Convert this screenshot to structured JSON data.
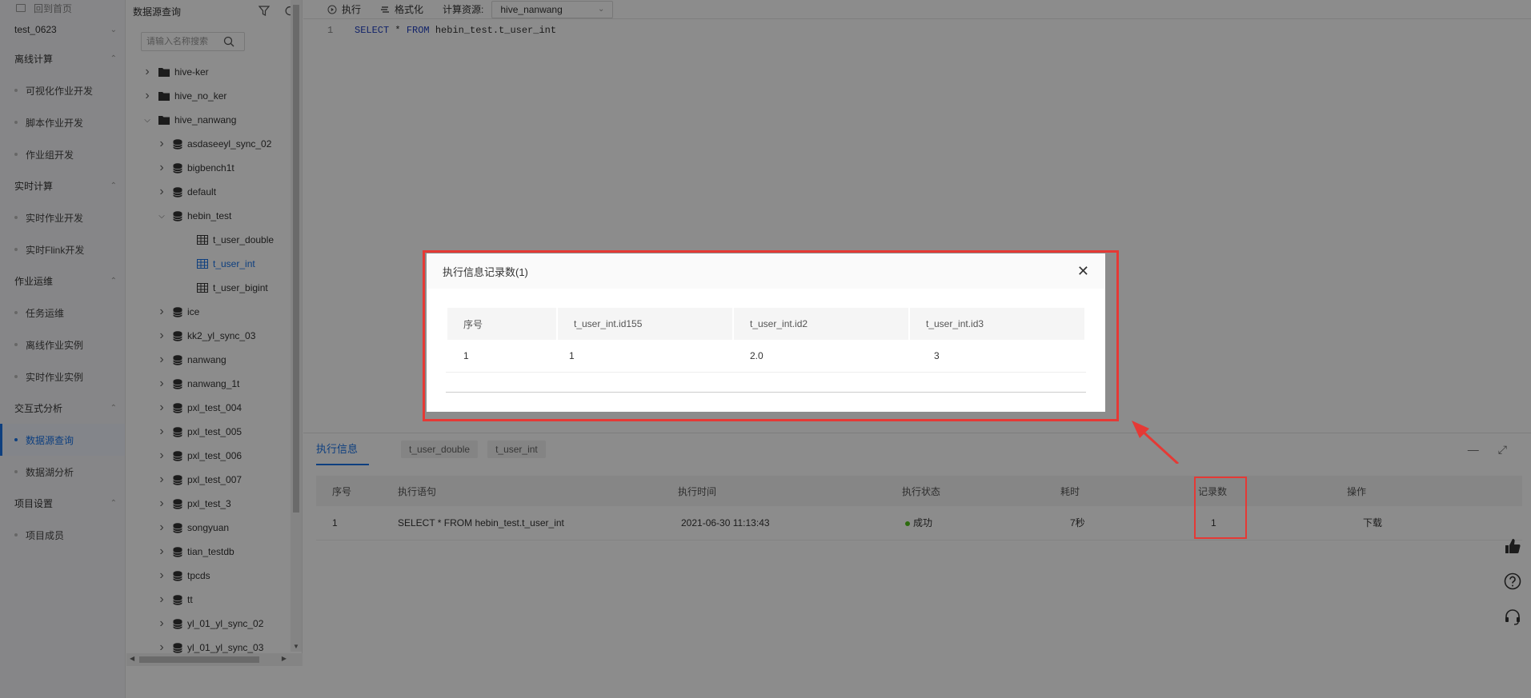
{
  "nav": {
    "home_label": "回到首页",
    "project": "test_0623",
    "groups": [
      {
        "label": "离线计算",
        "items": [
          "可视化作业开发",
          "脚本作业开发",
          "作业组开发"
        ]
      },
      {
        "label": "实时计算",
        "items": [
          "实时作业开发",
          "实时Flink开发"
        ]
      },
      {
        "label": "作业运维",
        "items": [
          "任务运维",
          "离线作业实例",
          "实时作业实例"
        ]
      },
      {
        "label": "交互式分析",
        "items": [
          "数据源查询",
          "数据湖分析"
        ]
      },
      {
        "label": "项目设置",
        "items": [
          "项目成员"
        ]
      }
    ],
    "active_item": "数据源查询"
  },
  "tree": {
    "title": "数据源查询",
    "search_placeholder": "请输入名称搜索",
    "nodes": [
      {
        "label": "hive-ker",
        "type": "folder",
        "level": 0,
        "expanded": false
      },
      {
        "label": "hive_no_ker",
        "type": "folder",
        "level": 0,
        "expanded": false
      },
      {
        "label": "hive_nanwang",
        "type": "folder",
        "level": 0,
        "expanded": true
      },
      {
        "label": "asdaseeyl_sync_02",
        "type": "db",
        "level": 1,
        "expanded": false
      },
      {
        "label": "bigbench1t",
        "type": "db",
        "level": 1,
        "expanded": false
      },
      {
        "label": "default",
        "type": "db",
        "level": 1,
        "expanded": false
      },
      {
        "label": "hebin_test",
        "type": "db",
        "level": 1,
        "expanded": true
      },
      {
        "label": "t_user_double",
        "type": "table",
        "level": 2
      },
      {
        "label": "t_user_int",
        "type": "table",
        "level": 2,
        "selected": true
      },
      {
        "label": "t_user_bigint",
        "type": "table",
        "level": 2
      },
      {
        "label": "ice",
        "type": "db",
        "level": 1,
        "expanded": false
      },
      {
        "label": "kk2_yl_sync_03",
        "type": "db",
        "level": 1,
        "expanded": false
      },
      {
        "label": "nanwang",
        "type": "db",
        "level": 1,
        "expanded": false
      },
      {
        "label": "nanwang_1t",
        "type": "db",
        "level": 1,
        "expanded": false
      },
      {
        "label": "pxl_test_004",
        "type": "db",
        "level": 1,
        "expanded": false
      },
      {
        "label": "pxl_test_005",
        "type": "db",
        "level": 1,
        "expanded": false
      },
      {
        "label": "pxl_test_006",
        "type": "db",
        "level": 1,
        "expanded": false
      },
      {
        "label": "pxl_test_007",
        "type": "db",
        "level": 1,
        "expanded": false
      },
      {
        "label": "pxl_test_3",
        "type": "db",
        "level": 1,
        "expanded": false
      },
      {
        "label": "songyuan",
        "type": "db",
        "level": 1,
        "expanded": false
      },
      {
        "label": "tian_testdb",
        "type": "db",
        "level": 1,
        "expanded": false
      },
      {
        "label": "tpcds",
        "type": "db",
        "level": 1,
        "expanded": false
      },
      {
        "label": "tt",
        "type": "db",
        "level": 1,
        "expanded": false
      },
      {
        "label": "yl_01_yl_sync_02",
        "type": "db",
        "level": 1,
        "expanded": false
      },
      {
        "label": "yl_01_yl_sync_03",
        "type": "db",
        "level": 1,
        "expanded": false
      }
    ]
  },
  "toolbar": {
    "run_label": "执行",
    "format_label": "格式化",
    "resource_label": "计算资源:",
    "resource_value": "hive_nanwang"
  },
  "editor": {
    "line_no": "1",
    "kw_select": "SELECT",
    "star": " * ",
    "kw_from": "FROM",
    "table": " hebin_test.t_user_int"
  },
  "bottom": {
    "tab_main": "执行信息",
    "tab_chips": [
      "t_user_double",
      "t_user_int"
    ],
    "headers": [
      "序号",
      "执行语句",
      "执行时间",
      "执行状态",
      "耗时",
      "记录数",
      "操作"
    ],
    "row": {
      "index": "1",
      "statement": "SELECT * FROM hebin_test.t_user_int",
      "time": "2021-06-30 11:13:43",
      "status": "成功",
      "duration": "7秒",
      "records": "1",
      "action": "下载"
    }
  },
  "modal": {
    "title": "执行信息记录数(1)",
    "headers": [
      "序号",
      "t_user_int.id155",
      "t_user_int.id2",
      "t_user_int.id3"
    ],
    "rows": [
      [
        "1",
        "1",
        "2.0",
        "3"
      ]
    ]
  },
  "colors": {
    "accent": "#1a73e8",
    "highlight": "#e53935",
    "success": "#52c41a"
  }
}
